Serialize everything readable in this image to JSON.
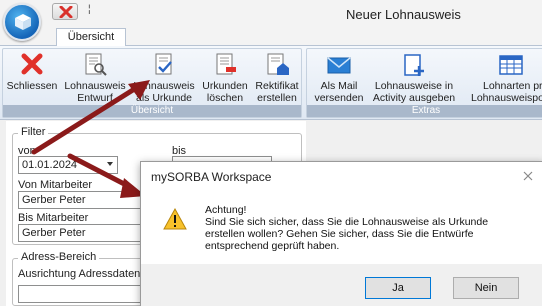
{
  "window": {
    "title": "Neuer Lohnausweis",
    "qat_menu_glyph": "¦"
  },
  "ribbon": {
    "active_tab": "Übersicht",
    "groups": [
      {
        "caption": "Übersicht"
      },
      {
        "caption": "Extras"
      }
    ],
    "buttons": {
      "schliessen": {
        "line1": "Schliessen",
        "line2": "",
        "icon": "close-x-icon"
      },
      "lohnausweis_entwurf": {
        "line1": "Lohnausweis",
        "line2": "Entwurf",
        "icon": "document-search-icon"
      },
      "lohnausweis_urkunde": {
        "line1": "Lohnausweis",
        "line2": "als Urkunde",
        "icon": "document-check-icon"
      },
      "urkunden_loeschen": {
        "line1": "Urkunden",
        "line2": "löschen",
        "icon": "document-delete-icon"
      },
      "rektifikat_erstellen": {
        "line1": "Rektifikat",
        "line2": "erstellen",
        "icon": "document-home-icon"
      },
      "als_mail_versenden": {
        "line1": "Als Mail",
        "line2": "versenden",
        "icon": "envelope-icon"
      },
      "activity_ausgeben": {
        "line1": "Lohnausweise in",
        "line2": "Activity ausgeben",
        "icon": "document-add-icon"
      },
      "lohnarten_pruefen": {
        "line1": "Lohnarten pr",
        "line2": "Lohnausweispos",
        "icon": "table-grid-icon"
      }
    }
  },
  "filter": {
    "legend": "Filter",
    "von_label": "von",
    "bis_label": "bis",
    "von_value": "01.01.2024",
    "von_mitarbeiter_label": "Von Mitarbeiter",
    "von_mitarbeiter_value": "Gerber Peter",
    "bis_mitarbeiter_label": "Bis Mitarbeiter",
    "bis_mitarbeiter_value": "Gerber Peter"
  },
  "adress": {
    "legend": "Adress-Bereich",
    "ausrichtung_label": "Ausrichtung Adressdaten"
  },
  "dialog": {
    "title": "mySORBA Workspace",
    "heading": "Achtung!",
    "message_line1": "Sind Sie sich sicher, dass Sie die Lohnausweise als Urkunde",
    "message_line2": "erstellen wollen? Gehen Sie sicher, dass Sie die Entwürfe",
    "message_line3": "entsprechend geprüft haben.",
    "ja_label": "Ja",
    "nein_label": "Nein"
  },
  "colors": {
    "ribbon_caption": "#a9b8cb",
    "arrow": "#8b1a1a",
    "focus": "#0078d7"
  }
}
